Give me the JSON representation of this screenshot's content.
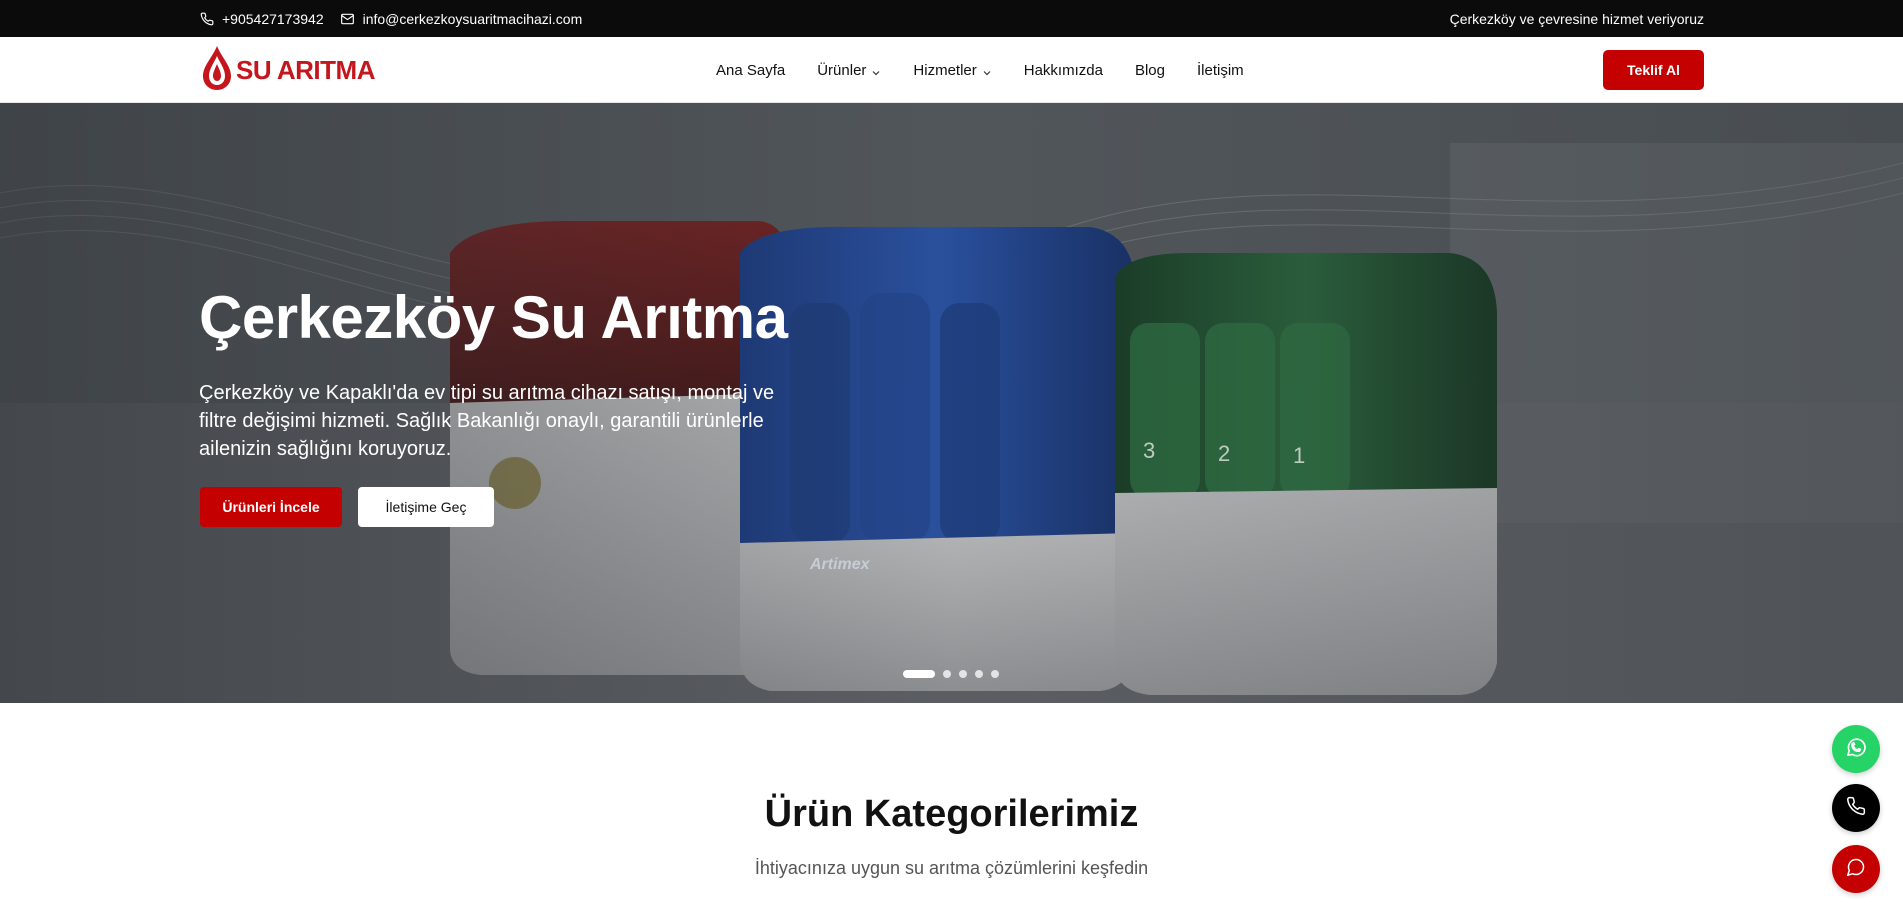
{
  "topbar": {
    "phone": "+905427173942",
    "email": "info@cerkezkoysuaritmacihazi.com",
    "tagline": "Çerkezköy ve çevresine hizmet veriyoruz"
  },
  "header": {
    "logo_text": "SU ARITMA",
    "nav": [
      {
        "label": "Ana Sayfa",
        "has_dropdown": false
      },
      {
        "label": "Ürünler",
        "has_dropdown": true
      },
      {
        "label": "Hizmetler",
        "has_dropdown": true
      },
      {
        "label": "Hakkımızda",
        "has_dropdown": false
      },
      {
        "label": "Blog",
        "has_dropdown": false
      },
      {
        "label": "İletişim",
        "has_dropdown": false
      }
    ],
    "cta_label": "Teklif Al"
  },
  "hero": {
    "title": "Çerkezköy Su Arıtma",
    "subtitle": "Çerkezköy ve Kapaklı'da ev tipi su arıtma cihazı satışı, montaj ve filtre değişimi hizmeti. Sağlık Bakanlığı onaylı, garantili ürünlerle ailenizin sağlığını koruyoruz.",
    "primary_button": "Ürünleri İncele",
    "secondary_button": "İletişime Geç",
    "slides_total": 5,
    "active_slide": 1,
    "image_brand_mark": "Artimex",
    "filter_numbers": [
      "3",
      "2",
      "1"
    ]
  },
  "categories": {
    "title": "Ürün Kategorilerimiz",
    "subtitle": "İhtiyacınıza uygun su arıtma çözümlerini keşfedin"
  },
  "floating": {
    "icons": [
      "whatsapp-icon",
      "phone-icon",
      "chat-icon"
    ]
  },
  "colors": {
    "brand_red": "#c40000",
    "topbar_bg": "#0b0b0b",
    "whatsapp_green": "#25d366"
  }
}
